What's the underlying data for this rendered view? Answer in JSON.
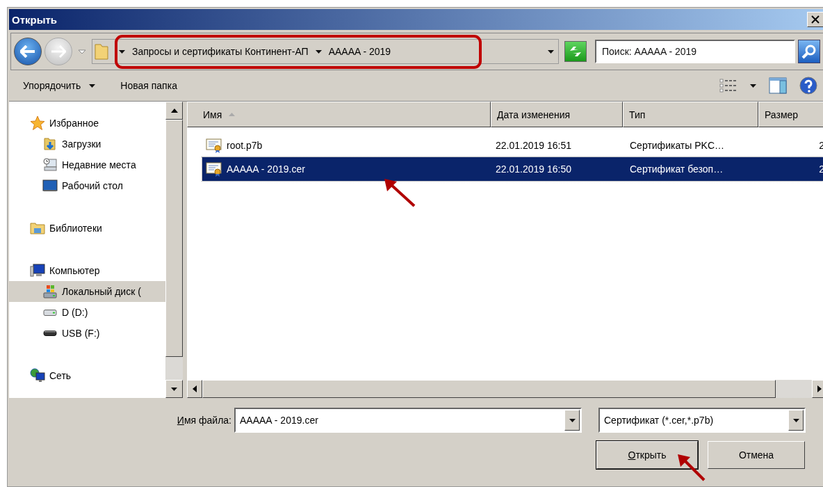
{
  "window": {
    "title": "Открыть"
  },
  "navigation": {
    "path": [
      "Запросы и сертификаты Континент-АП",
      "AAAAA - 2019"
    ],
    "search": {
      "placeholder": "Поиск: AAAAA - 2019"
    }
  },
  "toolbar": {
    "buttons": [
      {
        "label": "Упорядочить",
        "dropdown": true
      },
      {
        "label": "Новая папка",
        "dropdown": false
      }
    ]
  },
  "sidebar": {
    "items": [
      {
        "label": "Избранное",
        "kind": "favorites",
        "selected": false,
        "children": [
          {
            "label": "Загрузки",
            "kind": "downloads",
            "selected": false
          },
          {
            "label": "Недавние места",
            "kind": "recent",
            "selected": false
          },
          {
            "label": "Рабочий стол",
            "kind": "desktop",
            "selected": false
          }
        ]
      },
      {
        "label": "Библиотеки",
        "kind": "libraries",
        "selected": false
      },
      {
        "label": "Компьютер",
        "kind": "computer",
        "selected": false,
        "children": [
          {
            "label": "Локальный диск (",
            "kind": "system",
            "selected": true
          },
          {
            "label": "D (D:)",
            "kind": "disk",
            "selected": false
          },
          {
            "label": "USB (F:)",
            "kind": "usb",
            "selected": false
          }
        ]
      },
      {
        "label": "Сеть",
        "kind": "network",
        "selected": false
      }
    ]
  },
  "file_list": {
    "columns": [
      {
        "label": "Имя",
        "sorted": true
      },
      {
        "label": "Дата изменения",
        "sorted": false
      },
      {
        "label": "Тип",
        "sorted": false
      },
      {
        "label": "Размер",
        "sorted": false
      }
    ],
    "rows": [
      {
        "name": "root.p7b",
        "date": "22.01.2019 16:51",
        "type": "Сертификаты PKC…",
        "size": "2",
        "selected": false
      },
      {
        "name": "AAAAA - 2019.cer",
        "date": "22.01.2019 16:50",
        "type": "Сертификат безоп…",
        "size": "2",
        "selected": true
      }
    ]
  },
  "footer": {
    "file_name_label": {
      "text": "Имя файла:",
      "underline_first": true
    },
    "file_name": "AAAAA - 2019.cer",
    "file_type": "Сертификат (*.cer,*.p7b)",
    "buttons": [
      {
        "label": "Открыть",
        "default": true,
        "underline_first": true
      },
      {
        "label": "Отмена",
        "default": false,
        "underline_first": false
      }
    ]
  },
  "annotations": [
    {
      "kind": "frame"
    },
    {
      "kind": "arrow"
    },
    {
      "kind": "arrow"
    }
  ]
}
